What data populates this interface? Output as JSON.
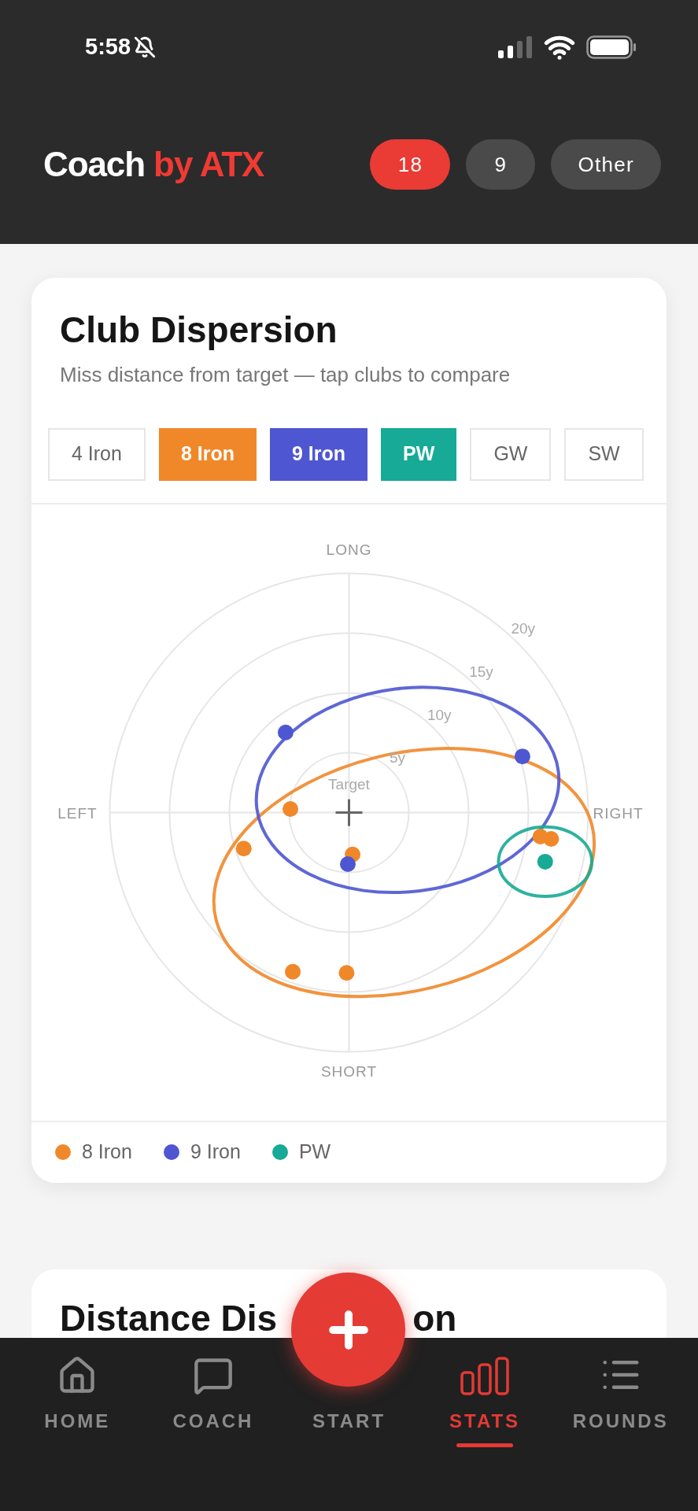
{
  "status_bar": {
    "time": "5:58"
  },
  "header": {
    "logo": {
      "primary": "Coach",
      "accent": "by ATX"
    },
    "holes": [
      {
        "label": "18",
        "selected": true
      },
      {
        "label": "9",
        "selected": false
      },
      {
        "label": "Other",
        "selected": false
      }
    ]
  },
  "dispersion_card": {
    "title": "Club Dispersion",
    "subtitle": "Miss distance from target — tap clubs to compare",
    "chips": [
      {
        "label": "4 Iron",
        "selected": false
      },
      {
        "label": "8 Iron",
        "selected": true,
        "color": "#f0882a"
      },
      {
        "label": "9 Iron",
        "selected": true,
        "color": "#4e57d1"
      },
      {
        "label": "PW",
        "selected": true,
        "color": "#17aa96"
      },
      {
        "label": "GW",
        "selected": false
      },
      {
        "label": "SW",
        "selected": false
      }
    ],
    "direction_labels": {
      "long": "LONG",
      "short": "SHORT",
      "left": "LEFT",
      "right": "RIGHT"
    },
    "target_label": "Target",
    "ring_labels": [
      "5y",
      "10y",
      "15y",
      "20y"
    ],
    "legend": [
      {
        "label": "8 Iron",
        "color": "#f0882a"
      },
      {
        "label": "9 Iron",
        "color": "#4e57d1"
      },
      {
        "label": "PW",
        "color": "#17aa96"
      }
    ]
  },
  "next_card": {
    "title_start": "Distance Dis",
    "title_end": "on"
  },
  "nav": [
    {
      "label": "HOME",
      "kind": "home",
      "selected": false
    },
    {
      "label": "COACH",
      "kind": "coach",
      "selected": false
    },
    {
      "label": "START",
      "kind": "start",
      "selected": false
    },
    {
      "label": "STATS",
      "kind": "stats",
      "selected": true
    },
    {
      "label": "ROUNDS",
      "kind": "rounds",
      "selected": false
    }
  ]
}
